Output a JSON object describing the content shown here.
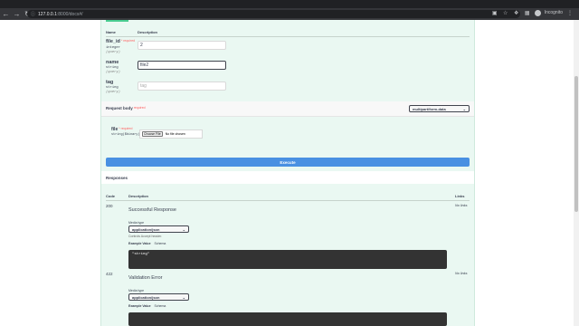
{
  "browser": {
    "url_host": "127.0.0.1",
    "url_path": ":8000/docs#/",
    "profile_label": "Incognito"
  },
  "params": {
    "header_name": "Name",
    "header_description": "Description",
    "required_label": "* required",
    "items": [
      {
        "name": "file_id",
        "required": true,
        "type": "integer",
        "in": "(query)",
        "value": "2",
        "placeholder": ""
      },
      {
        "name": "name",
        "required": false,
        "type": "string",
        "in": "(query)",
        "value": "file2",
        "placeholder": ""
      },
      {
        "name": "tag",
        "required": false,
        "type": "string",
        "in": "(query)",
        "value": "",
        "placeholder": "tag"
      }
    ]
  },
  "request_body": {
    "title": "Request body",
    "required_label": "required",
    "content_type": "multipart/form-data",
    "file_field": {
      "name": "file",
      "required_label": "* required",
      "type": "string($binary)",
      "choose_label": "Choose File",
      "no_file_label": "No file chosen"
    }
  },
  "execute_label": "Execute",
  "responses": {
    "title": "Responses",
    "col_code": "Code",
    "col_description": "Description",
    "col_links": "Links",
    "items": [
      {
        "code": "200",
        "description": "Successful Response",
        "links": "No links",
        "media_type_label": "Media type",
        "media_type": "application/json",
        "controls_label": "Controls Accept header.",
        "example_tab": "Example Value",
        "schema_tab": "Schema",
        "example": "\"string\""
      },
      {
        "code": "422",
        "description": "Validation Error",
        "links": "No links",
        "media_type_label": "Media type",
        "media_type": "application/json",
        "example_tab": "Example Value",
        "schema_tab": "Schema"
      }
    ]
  },
  "colors": {
    "panel_bg": "#eaf8f2",
    "accent_green": "#49cc90",
    "execute_blue": "#4990e2",
    "required_red": "#ff6060"
  }
}
